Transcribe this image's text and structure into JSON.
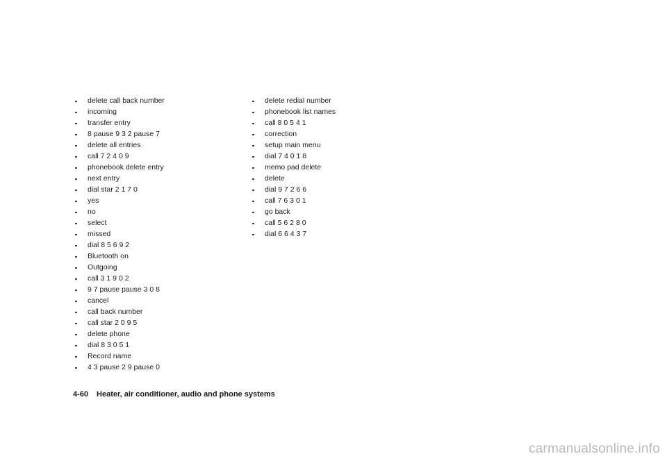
{
  "document": {
    "left_column_items": [
      "delete call back number",
      "incoming",
      "transfer entry",
      "8 pause 9 3 2 pause 7",
      "delete all entries",
      "call 7 2 4 0 9",
      "phonebook delete entry",
      "next entry",
      "dial star 2 1 7 0",
      "yes",
      "no",
      "select",
      "missed",
      "dial 8 5 6 9 2",
      "Bluetooth on",
      "Outgoing",
      "call 3 1 9 0 2",
      "9 7 pause pause 3 0 8",
      "cancel",
      "call back number",
      "call star 2 0 9 5",
      "delete phone",
      "dial 8 3 0 5 1",
      "Record name",
      "4 3 pause 2 9 pause 0"
    ],
    "right_column_items": [
      "delete redial number",
      "phonebook list names",
      "call 8 0 5 4 1",
      "correction",
      "setup main menu",
      "dial 7 4 0 1 8",
      "memo pad delete",
      "delete",
      "dial 9 7 2 6 6",
      "call 7 6 3 0 1",
      "go back",
      "call 5 6 2 8 0",
      "dial 6 6 4 3 7"
    ],
    "footer": {
      "page_number": "4-60",
      "chapter_title": "Heater, air conditioner, audio and phone systems"
    },
    "watermark": "carmanualsonline.info"
  }
}
